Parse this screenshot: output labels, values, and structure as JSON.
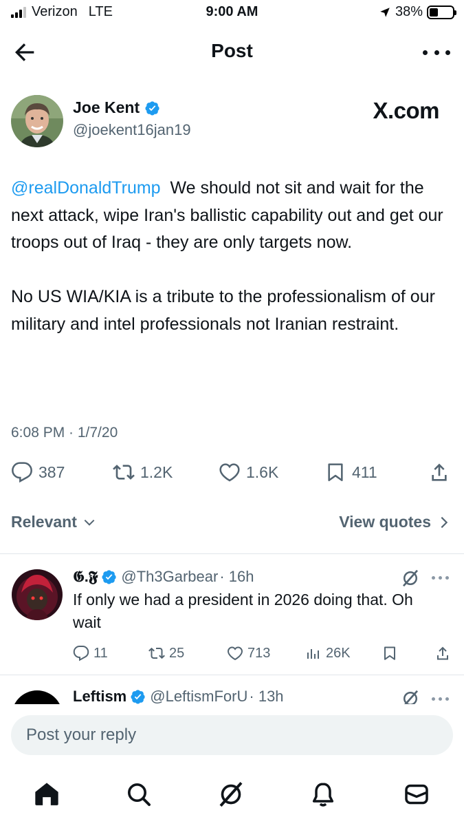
{
  "status_bar": {
    "carrier": "Verizon",
    "network": "LTE",
    "time": "9:00 AM",
    "battery": "38%",
    "battery_level": 0.38,
    "signal_bars": 3,
    "location_icon": "location-arrow-icon"
  },
  "header": {
    "title": "Post",
    "back_icon": "back-arrow-icon",
    "more_icon": "more-horizontal-icon"
  },
  "post": {
    "author_name": "Joe Kent",
    "author_handle": "@joekent16jan19",
    "verified": true,
    "watermark": "X.com",
    "mention": "@realDonaldTrump",
    "text_p1": "We should not sit and wait for the next attack, wipe Iran's ballistic capability out and get our troops out of Iraq - they are only targets now.",
    "text_p2": "No US WIA/KIA is a tribute to the professionalism of our military and intel professionals not Iranian restraint.",
    "timestamp": "6:08 PM · 1/7/20",
    "stats": {
      "replies": "387",
      "reposts": "1.2K",
      "likes": "1.6K",
      "bookmarks": "411"
    }
  },
  "sort": {
    "label": "Relevant",
    "view_quotes": "View quotes"
  },
  "replies": [
    {
      "name": "𝕲.𝕱",
      "handle": "@Th3Garbear",
      "time": "· 16h",
      "text": "If only we had a president in 2026 doing that. Oh wait",
      "stats": {
        "replies": "11",
        "reposts": "25",
        "likes": "713",
        "views": "26K"
      }
    },
    {
      "name": "Leftism",
      "handle": "@LeftismForU",
      "time": "· 13h"
    }
  ],
  "composer": {
    "placeholder": "Post your reply"
  },
  "colors": {
    "accent": "#1d9bf0",
    "secondary_text": "#536471",
    "primary_text": "#0f1419"
  }
}
